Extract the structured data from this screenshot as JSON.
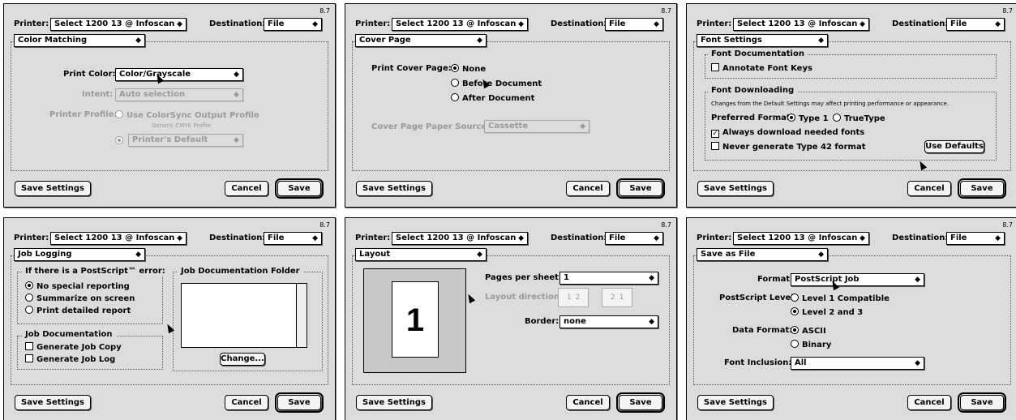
{
  "common": {
    "printer_label": "Printer:",
    "printer_value": "Select 1200 13 @ Infoscan",
    "dest_label": "Destination:",
    "dest_value": "File",
    "version": "8.7",
    "save_settings": "Save Settings",
    "cancel": "Cancel",
    "save": "Save"
  },
  "p1": {
    "menu": "Color Matching",
    "print_color_label": "Print Color:",
    "print_color": "Color/Grayscale",
    "intent_label": "Intent:",
    "intent": "Auto selection",
    "profile_label": "Printer Profile:",
    "colorsync": "Use ColorSync Output Profile",
    "generic": "Generic CMYK Profile",
    "printers_default": "Printer's Default"
  },
  "p2": {
    "menu": "Cover Page",
    "label": "Print Cover Page:",
    "none": "None",
    "before": "Before Document",
    "after": "After Document",
    "source_label": "Cover Page Paper Source:",
    "source": "Cassette"
  },
  "p3": {
    "menu": "Font Settings",
    "doc_title": "Font Documentation",
    "annotate": "Annotate Font Keys",
    "dl_title": "Font Downloading",
    "note": "Changes from the Default Settings may affect printing performance or appearance.",
    "pref_label": "Preferred Format:",
    "type1": "Type 1",
    "truetype": "TrueType",
    "always": "Always download needed fonts",
    "never": "Never generate Type 42 format",
    "use_defaults": "Use Defaults"
  },
  "p4": {
    "menu": "Job Logging",
    "err_title": "If there is a PostScript™ error:",
    "no_report": "No special reporting",
    "summarize": "Summarize on screen",
    "detailed": "Print detailed report",
    "jobdoc_title": "Job Documentation",
    "copy": "Generate Job Copy",
    "log": "Generate Job Log",
    "folder_title": "Job Documentation Folder",
    "change": "Change..."
  },
  "p5": {
    "menu": "Layout",
    "preview": "1",
    "pps_label": "Pages per sheet:",
    "pps": "1",
    "dir_label": "Layout direction:",
    "dir1": "1 2",
    "dir2": "2 1",
    "border_label": "Border:",
    "border": "none"
  },
  "p6": {
    "menu": "Save as File",
    "format_label": "Format:",
    "format": "PostScript Job",
    "level_label": "PostScript Level:",
    "level1": "Level 1 Compatible",
    "level2": "Level 2 and 3",
    "data_label": "Data Format:",
    "ascii": "ASCII",
    "binary": "Binary",
    "font_label": "Font Inclusion:",
    "font": "All"
  }
}
